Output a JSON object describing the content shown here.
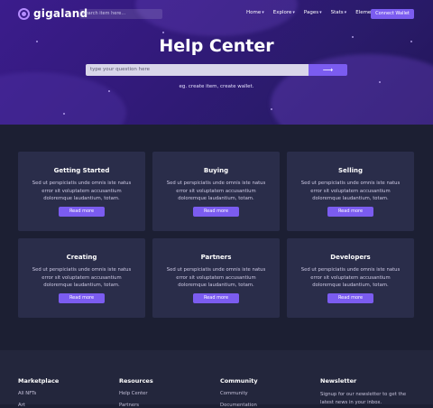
{
  "brand": {
    "name": "gigaland"
  },
  "nav": {
    "search_placeholder": "search item here...",
    "menu": [
      {
        "label": "Home"
      },
      {
        "label": "Explore"
      },
      {
        "label": "Pages"
      },
      {
        "label": "Stats"
      },
      {
        "label": "Elements"
      }
    ],
    "connect_label": "Connect Wallet"
  },
  "hero": {
    "title": "Help Center",
    "search_placeholder": "type your question here",
    "search_button_icon": "arrow-right-icon",
    "hint": "eg. create item, create wallet."
  },
  "cards": [
    {
      "title": "Getting Started",
      "text": "Sed ut perspiciatis unde omnis iste natus error sit voluptatem accusantium doloremque laudantium, totam.",
      "button": "Read more"
    },
    {
      "title": "Buying",
      "text": "Sed ut perspiciatis unde omnis iste natus error sit voluptatem accusantium doloremque laudantium, totam.",
      "button": "Read more"
    },
    {
      "title": "Selling",
      "text": "Sed ut perspiciatis unde omnis iste natus error sit voluptatem accusantium doloremque laudantium, totam.",
      "button": "Read more"
    },
    {
      "title": "Creating",
      "text": "Sed ut perspiciatis unde omnis iste natus error sit voluptatem accusantium doloremque laudantium, totam.",
      "button": "Read more"
    },
    {
      "title": "Partners",
      "text": "Sed ut perspiciatis unde omnis iste natus error sit voluptatem accusantium doloremque laudantium, totam.",
      "button": "Read more"
    },
    {
      "title": "Developers",
      "text": "Sed ut perspiciatis unde omnis iste natus error sit voluptatem accusantium doloremque laudantium, totam.",
      "button": "Read more"
    }
  ],
  "footer": {
    "marketplace": {
      "title": "Marketplace",
      "links": [
        "All NFTs",
        "Art"
      ]
    },
    "resources": {
      "title": "Resources",
      "links": [
        "Help Center",
        "Partners"
      ]
    },
    "community": {
      "title": "Community",
      "links": [
        "Community",
        "Documentation"
      ]
    },
    "newsletter": {
      "title": "Newsletter",
      "text": "Signup for our newsletter to get the latest news in your inbox."
    }
  },
  "colors": {
    "accent": "#7b5cf0",
    "page_bg": "#1c1f33",
    "card_bg": "#2a2d4a"
  }
}
